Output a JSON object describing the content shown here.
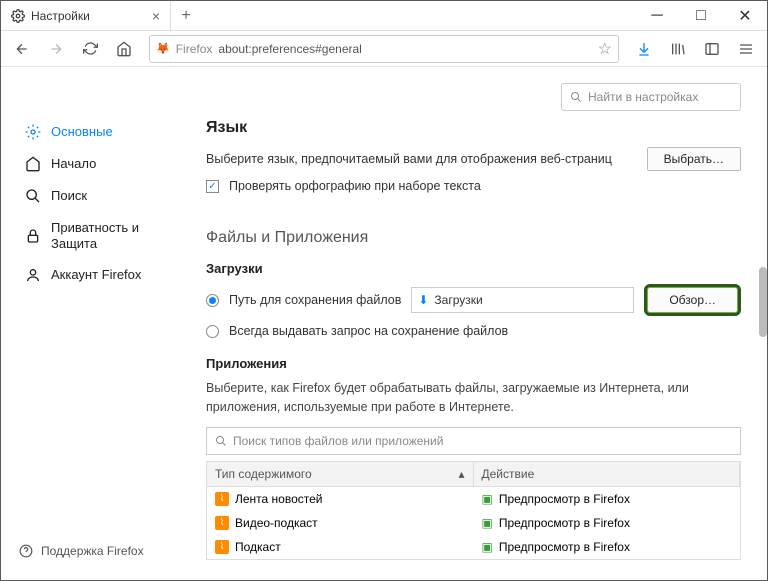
{
  "tab": {
    "title": "Настройки"
  },
  "url": {
    "prefix": "Firefox",
    "value": "about:preferences#general"
  },
  "searchPrefs": {
    "placeholder": "Найти в настройках"
  },
  "sidebar": {
    "items": [
      {
        "label": "Основные"
      },
      {
        "label": "Начало"
      },
      {
        "label": "Поиск"
      },
      {
        "label": "Приватность и Защита"
      },
      {
        "label": "Аккаунт Firefox"
      }
    ],
    "support": "Поддержка Firefox"
  },
  "lang": {
    "heading": "Язык",
    "desc": "Выберите язык, предпочитаемый вами для отображения веб-страниц",
    "chooseBtn": "Выбрать…",
    "spellcheck": "Проверять орфографию при наборе текста"
  },
  "files": {
    "heading": "Файлы и Приложения",
    "downloads": "Загрузки",
    "saveTo": "Путь для сохранения файлов",
    "folder": "Загрузки",
    "browseBtn": "Обзор…",
    "alwaysAsk": "Всегда выдавать запрос на сохранение файлов"
  },
  "apps": {
    "heading": "Приложения",
    "desc": "Выберите, как Firefox будет обрабатывать файлы, загружаемые из Интернета, или приложения, используемые при работе в Интернете.",
    "searchPlaceholder": "Поиск типов файлов или приложений",
    "colType": "Тип содержимого",
    "colAction": "Действие",
    "rows": [
      {
        "type": "Лента новостей",
        "action": "Предпросмотр в Firefox"
      },
      {
        "type": "Видео-подкаст",
        "action": "Предпросмотр в Firefox"
      },
      {
        "type": "Подкаст",
        "action": "Предпросмотр в Firefox"
      }
    ]
  }
}
